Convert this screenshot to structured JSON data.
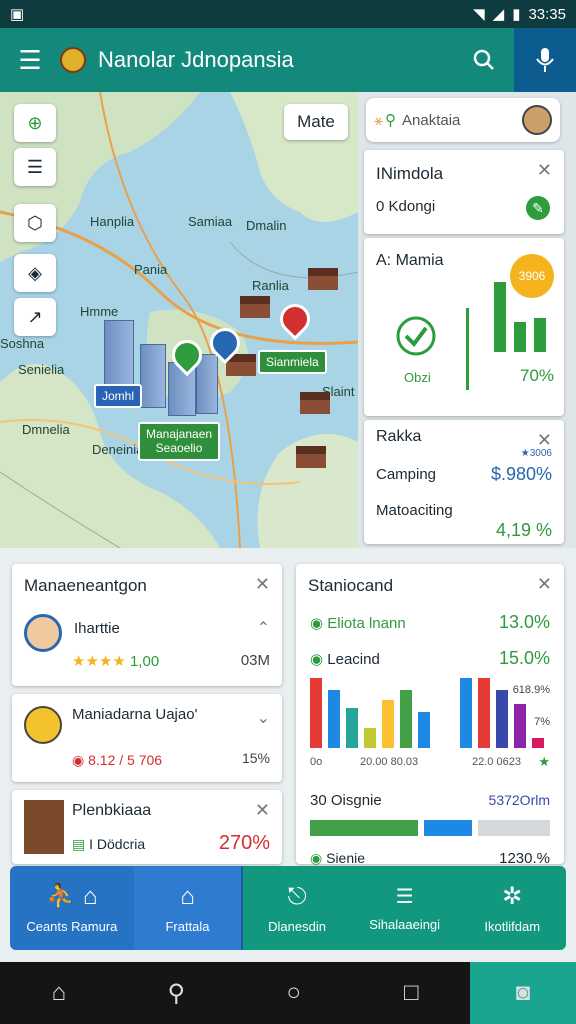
{
  "status": {
    "time": "33:35"
  },
  "app": {
    "title": "Nanolar Jdnopansia"
  },
  "map": {
    "mate_label": "Mate",
    "labels": [
      "Hanplia",
      "Samiaa",
      "Pania",
      "Hmme",
      "Soshna",
      "Senielia",
      "Dmnelia",
      "Deneinia",
      "Slaint",
      "Ranlia",
      "Dmalin"
    ],
    "tags": {
      "tag1": "Jomhl",
      "tag2": "Sianmiela",
      "tag3": "Manajanaen\nSeaoelio"
    }
  },
  "right": {
    "search_text": "Anaktaia",
    "card1": {
      "title": "INimdola",
      "line": "0 Kdongi"
    },
    "card2": {
      "title": "A: Mamia",
      "badge": "3906",
      "left_label": "Obzi",
      "right_pct": "70%"
    },
    "card3": {
      "title": "Rakka",
      "row1_label": "Camping",
      "row1_value": "$.980%",
      "row1_note": "★3006",
      "row2_label": "Matoaciting",
      "row2_value": "4,19 %"
    }
  },
  "cards": {
    "mgmt": {
      "title": "Manaeneantgon",
      "items": [
        {
          "name": "Iharttie",
          "rating": "1,00",
          "value": "03M"
        },
        {
          "name": "Maniadarna Uajao'",
          "sub": "8.12 / 5 706",
          "value": "15%"
        },
        {
          "name": "Plenbkiaaa",
          "sub": "I Dödcria",
          "value": "270%"
        }
      ]
    },
    "stats": {
      "title": "Staniocand",
      "rows": [
        {
          "label": "Eliota lnann",
          "value": "13.0%"
        },
        {
          "label": "Leacind",
          "value": "15.0%"
        }
      ],
      "bar_notes": {
        "a": "618.9%",
        "b": "7%"
      },
      "axis": {
        "l": "0o",
        "m": "20.00 80.03",
        "r": "22.0 0623"
      },
      "footer_label": "30 Oisgnie",
      "footer_value": "5372Orlm",
      "bottom_label": "Sienie",
      "bottom_value": "1230.%"
    }
  },
  "nav": [
    {
      "label": "Ceants Ramura"
    },
    {
      "label": "Frattala"
    },
    {
      "label": "Dlanesdin"
    },
    {
      "label": "Sihalaaeingi"
    },
    {
      "label": "Ikotlifdam"
    }
  ]
}
